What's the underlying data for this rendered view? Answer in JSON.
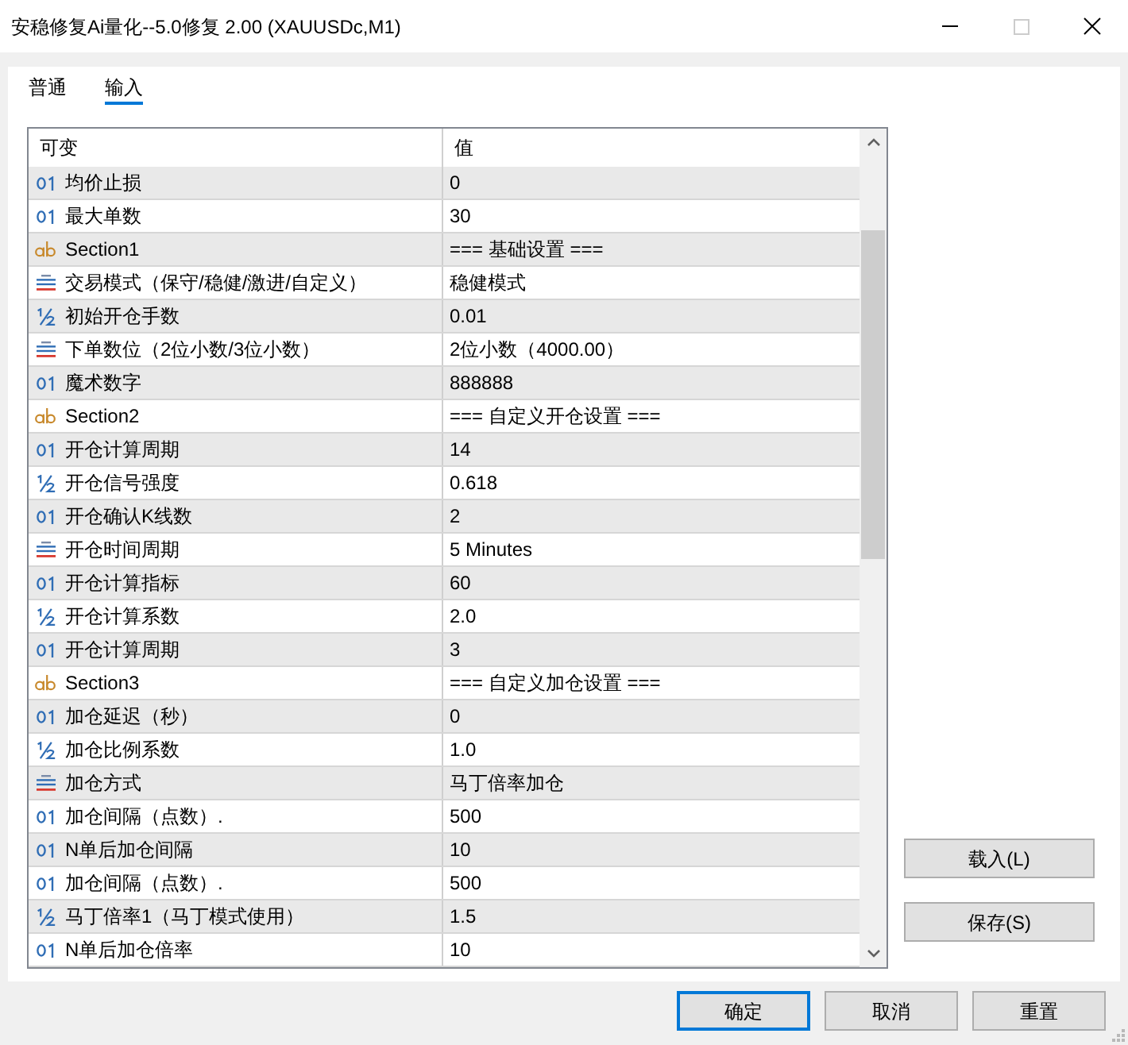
{
  "window": {
    "title": "安稳修复Ai量化--5.0修复 2.00 (XAUUSDc,M1)",
    "maximize_disabled": true
  },
  "tabs": [
    {
      "label": "普通",
      "selected": false
    },
    {
      "label": "输入",
      "selected": true
    }
  ],
  "table": {
    "columns": [
      "可变",
      "值"
    ],
    "rows": [
      {
        "kind": "integer",
        "name": "均价止损",
        "value": "0"
      },
      {
        "kind": "integer",
        "name": "最大单数",
        "value": "30"
      },
      {
        "kind": "string",
        "name": "Section1",
        "value": "=== 基础设置 ==="
      },
      {
        "kind": "enum",
        "name": "交易模式（保守/稳健/激进/自定义）",
        "value": "稳健模式"
      },
      {
        "kind": "double",
        "name": "初始开仓手数",
        "value": "0.01"
      },
      {
        "kind": "enum",
        "name": "下单数位（2位小数/3位小数）",
        "value": "2位小数（4000.00）"
      },
      {
        "kind": "integer",
        "name": "魔术数字",
        "value": "888888"
      },
      {
        "kind": "string",
        "name": "Section2",
        "value": "=== 自定义开仓设置 ==="
      },
      {
        "kind": "integer",
        "name": "开仓计算周期",
        "value": "14"
      },
      {
        "kind": "double",
        "name": "开仓信号强度",
        "value": "0.618"
      },
      {
        "kind": "integer",
        "name": "开仓确认K线数",
        "value": "2"
      },
      {
        "kind": "enum",
        "name": "开仓时间周期",
        "value": "5 Minutes"
      },
      {
        "kind": "integer",
        "name": "开仓计算指标",
        "value": "60"
      },
      {
        "kind": "double",
        "name": "开仓计算系数",
        "value": "2.0"
      },
      {
        "kind": "integer",
        "name": "开仓计算周期",
        "value": "3"
      },
      {
        "kind": "string",
        "name": "Section3",
        "value": "=== 自定义加仓设置 ==="
      },
      {
        "kind": "integer",
        "name": "加仓延迟（秒）",
        "value": "0"
      },
      {
        "kind": "double",
        "name": "加仓比例系数",
        "value": "1.0"
      },
      {
        "kind": "enum",
        "name": "加仓方式",
        "value": "马丁倍率加仓"
      },
      {
        "kind": "integer",
        "name": "加仓间隔（点数）.",
        "value": "500"
      },
      {
        "kind": "integer",
        "name": "N单后加仓间隔",
        "value": "10"
      },
      {
        "kind": "integer",
        "name": "加仓间隔（点数）.",
        "value": "500"
      },
      {
        "kind": "double",
        "name": "马丁倍率1（马丁模式使用）",
        "value": "1.5"
      },
      {
        "kind": "integer",
        "name": "N单后加仓倍率",
        "value": "10"
      }
    ]
  },
  "side_buttons": [
    {
      "label": "载入(L)"
    },
    {
      "label": "保存(S)"
    }
  ],
  "buttons": [
    {
      "label": "确定",
      "default": true
    },
    {
      "label": "取消",
      "default": false
    },
    {
      "label": "重置",
      "default": false
    }
  ]
}
